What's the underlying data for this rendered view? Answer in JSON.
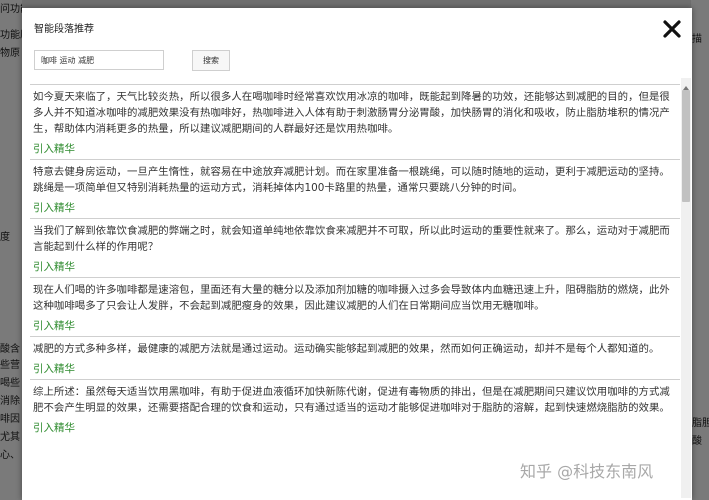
{
  "background": {
    "left_fragments": [
      "问功能介绍",
      "功能原",
      "物原",
      "度",
      "酸含",
      "些营",
      "喝些",
      "消除",
      "啡因",
      "尤其",
      "心、"
    ],
    "right_fragments": [
      "描",
      "脂胆",
      "酸"
    ]
  },
  "modal": {
    "title": "智能段落推荐",
    "close_icon": "close-icon",
    "search": {
      "value": "咖啡 运动 减肥",
      "button_label": "搜索"
    },
    "items": [
      {
        "text": "如今夏天来临了，天气比较炎热，所以很多人在喝咖啡时经常喜欢饮用冰凉的咖啡，既能起到降暑的功效，还能够达到减肥的目的，但是很多人并不知道冰咖啡的减肥效果没有热咖啡好，热咖啡进入人体有助于刺激肠胃分泌胃酸，加快肠胃的消化和吸收，防止脂肪堆积的情况产生，帮助体内消耗更多的热量，所以建议减肥期间的人群最好还是饮用热咖啡。",
        "link": "引入精华"
      },
      {
        "text": "特意去健身房运动，一旦产生惰性，就容易在中途放弃减肥计划。而在家里准备一根跳绳，可以随时随地的运动，更利于减肥运动的坚持。跳绳是一项简单但又特别消耗热量的运动方式，消耗掉体内100卡路里的热量，通常只要跳八分钟的时间。",
        "link": "引入精华"
      },
      {
        "text": "当我们了解到依靠饮食减肥的弊端之时，就会知道单纯地依靠饮食来减肥并不可取，所以此时运动的重要性就来了。那么，运动对于减肥而言能起到什么样的作用呢？",
        "link": "引入精华"
      },
      {
        "text": "现在人们喝的许多咖啡都是速溶包，里面还有大量的糖分以及添加剂加糖的咖啡摄入过多会导致体内血糖迅速上升，阻碍脂肪的燃烧，此外这种咖啡喝多了只会让人发胖，不会起到减肥瘦身的效果，因此建议减肥的人们在日常期间应当饮用无糖咖啡。",
        "link": "引入精华"
      },
      {
        "text": "减肥的方式多种多样，最健康的减肥方法就是通过运动。运动确实能够起到减肥的效果，然而如何正确运动，却并不是每个人都知道的。",
        "link": "引入精华"
      },
      {
        "text": "综上所述：虽然每天适当饮用黑咖啡，有助于促进血液循环加快新陈代谢，促进有毒物质的排出，但是在减肥期间只建议饮用咖啡的方式减肥不会产生明显的效果，还需要搭配合理的饮食和运动，只有通过适当的运动才能够促进咖啡对于脂肪的溶解，起到快速燃烧脂肪的效果。",
        "link": "引入精华"
      }
    ]
  },
  "watermark": "知乎 @科技东南风"
}
